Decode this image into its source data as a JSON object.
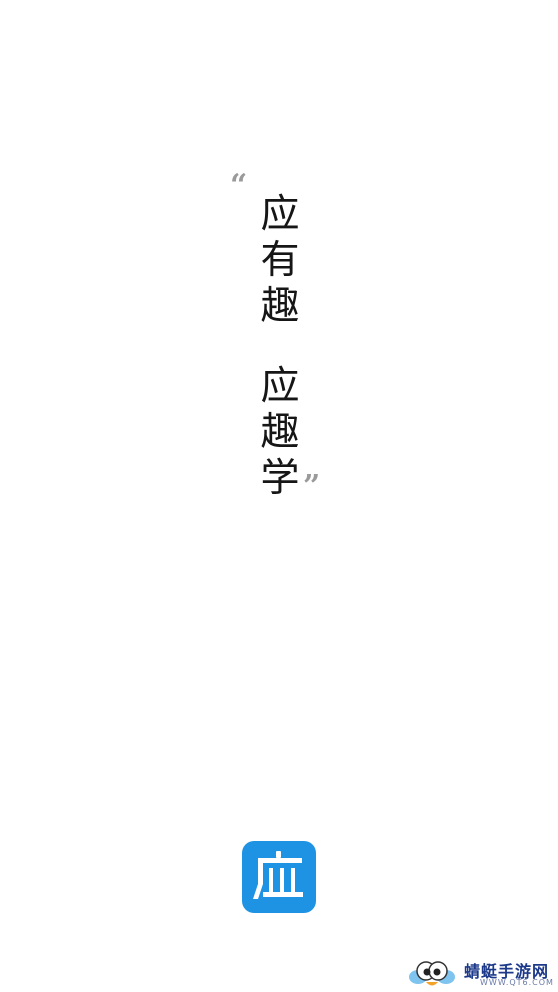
{
  "splash": {
    "quote_open": "“",
    "quote_close": "”",
    "slogan_part1": [
      "应",
      "有",
      "趣"
    ],
    "slogan_part2": [
      "应",
      "趣",
      "学"
    ]
  },
  "app_logo": {
    "glyph": "应",
    "color": "#1f93e3"
  },
  "watermark": {
    "name": "蜻蜓手游网",
    "url": "WWW.QT6.COM",
    "icon": "dragonfly-mascot-icon",
    "text_color": "#1d3a8a"
  }
}
